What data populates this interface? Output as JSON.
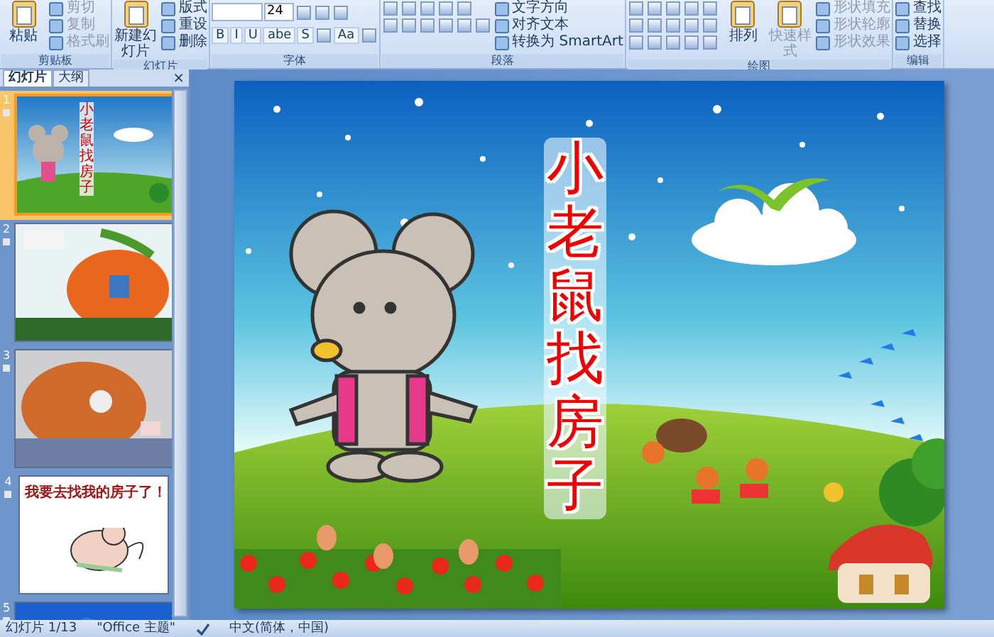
{
  "ribbon": {
    "groups": [
      {
        "label": "剪贴板",
        "columns": [
          [
            [
              {
                "kind": "large",
                "label": "粘贴",
                "disabled": false
              }
            ]
          ],
          [
            [
              {
                "kind": "small",
                "label": "剪切",
                "disabled": true
              }
            ],
            [
              {
                "kind": "small",
                "label": "复制",
                "disabled": true
              }
            ],
            [
              {
                "kind": "small",
                "label": "格式刷",
                "disabled": true
              }
            ]
          ]
        ]
      },
      {
        "label": "幻灯片",
        "columns": [
          [
            [
              {
                "kind": "large",
                "label": "新建幻灯片",
                "disabled": false
              }
            ]
          ],
          [
            [
              {
                "kind": "small",
                "label": "版式",
                "disabled": false
              }
            ],
            [
              {
                "kind": "small",
                "label": "重设",
                "disabled": false
              }
            ],
            [
              {
                "kind": "small",
                "label": "删除",
                "disabled": false
              }
            ]
          ]
        ]
      },
      {
        "label": "字体",
        "columns": [
          [
            [
              {
                "kind": "field"
              },
              {
                "kind": "field",
                "value": "24"
              },
              {
                "kind": "icon"
              },
              {
                "kind": "icon"
              },
              {
                "kind": "icon"
              }
            ],
            [
              {
                "kind": "tool",
                "label": "B"
              },
              {
                "kind": "tool",
                "label": "I"
              },
              {
                "kind": "tool",
                "label": "U"
              },
              {
                "kind": "tool",
                "label": "abe"
              },
              {
                "kind": "tool",
                "label": "S"
              },
              {
                "kind": "icon"
              },
              {
                "kind": "tool",
                "label": "Aa"
              },
              {
                "kind": "icon"
              }
            ]
          ]
        ]
      },
      {
        "label": "段落",
        "columns": [
          [
            [
              {
                "kind": "icon"
              },
              {
                "kind": "icon"
              },
              {
                "kind": "icon"
              },
              {
                "kind": "icon"
              },
              {
                "kind": "icon"
              }
            ],
            [
              {
                "kind": "icon"
              },
              {
                "kind": "icon"
              },
              {
                "kind": "icon"
              },
              {
                "kind": "icon"
              },
              {
                "kind": "icon"
              },
              {
                "kind": "icon"
              }
            ]
          ],
          [
            [
              {
                "kind": "small",
                "label": "文字方向",
                "disabled": false
              }
            ],
            [
              {
                "kind": "small",
                "label": "对齐文本",
                "disabled": false
              }
            ],
            [
              {
                "kind": "small",
                "label": "转换为 SmartArt",
                "disabled": false
              }
            ]
          ]
        ]
      },
      {
        "label": "绘图",
        "columns": [
          [
            [
              {
                "kind": "icon"
              },
              {
                "kind": "icon"
              },
              {
                "kind": "icon"
              },
              {
                "kind": "icon"
              },
              {
                "kind": "icon"
              }
            ],
            [
              {
                "kind": "icon"
              },
              {
                "kind": "icon"
              },
              {
                "kind": "icon"
              },
              {
                "kind": "icon"
              },
              {
                "kind": "icon"
              }
            ],
            [
              {
                "kind": "icon"
              },
              {
                "kind": "icon"
              },
              {
                "kind": "icon"
              },
              {
                "kind": "icon"
              },
              {
                "kind": "icon"
              }
            ]
          ],
          [
            [
              {
                "kind": "large",
                "label": "排列",
                "disabled": false
              }
            ]
          ],
          [
            [
              {
                "kind": "large",
                "label": "快速样式",
                "disabled": true
              }
            ]
          ],
          [
            [
              {
                "kind": "small",
                "label": "形状填充",
                "disabled": true
              }
            ],
            [
              {
                "kind": "small",
                "label": "形状轮廓",
                "disabled": true
              }
            ],
            [
              {
                "kind": "small",
                "label": "形状效果",
                "disabled": true
              }
            ]
          ]
        ]
      },
      {
        "label": "编辑",
        "columns": [
          [
            [
              {
                "kind": "small",
                "label": "查找",
                "disabled": false
              }
            ],
            [
              {
                "kind": "small",
                "label": "替换",
                "disabled": false
              }
            ],
            [
              {
                "kind": "small",
                "label": "选择",
                "disabled": false
              }
            ]
          ]
        ]
      }
    ]
  },
  "pane": {
    "tabs": [
      {
        "label": "幻灯片",
        "selected": true
      },
      {
        "label": "大纲",
        "selected": false
      }
    ],
    "close": "×",
    "slides": [
      {
        "number": "1",
        "selected": true,
        "kind": "title",
        "title": "小老鼠找房子"
      },
      {
        "number": "2",
        "selected": false,
        "kind": "pumpkin"
      },
      {
        "number": "3",
        "selected": false,
        "kind": "rain"
      },
      {
        "number": "4",
        "selected": false,
        "kind": "mouse",
        "title": "我要去找我的房子了！"
      },
      {
        "number": "5",
        "selected": false,
        "kind": "roof"
      }
    ]
  },
  "slide": {
    "title": "小老鼠找房子"
  },
  "status_bar": {
    "items": [
      "幻灯片 1/13",
      "\"Office 主题\"",
      "中文(简体，中国)"
    ]
  }
}
